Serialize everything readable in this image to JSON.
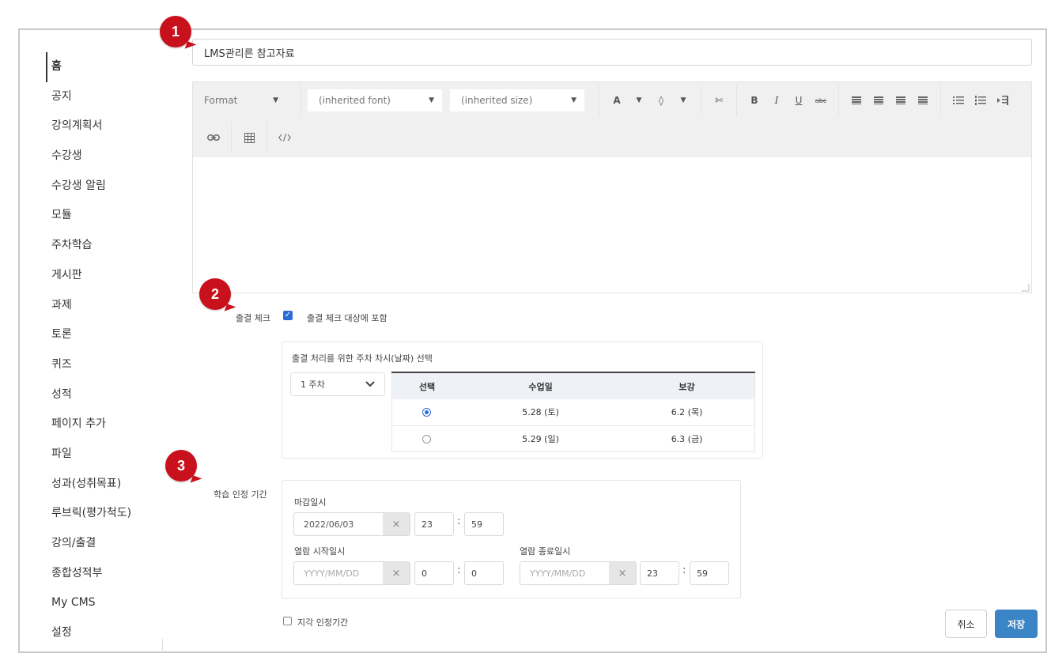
{
  "sidebar": {
    "items": [
      {
        "label": "홈",
        "active": true
      },
      {
        "label": "공지"
      },
      {
        "label": "강의계획서"
      },
      {
        "label": "수강생"
      },
      {
        "label": "수강생 알림"
      },
      {
        "label": "모듈"
      },
      {
        "label": "주차학습"
      },
      {
        "label": "게시판"
      },
      {
        "label": "과제"
      },
      {
        "label": "토론"
      },
      {
        "label": "퀴즈"
      },
      {
        "label": "성적"
      },
      {
        "label": "페이지 추가"
      },
      {
        "label": "파일"
      },
      {
        "label": "성과(성취목표)"
      },
      {
        "label": "루브릭(평가척도)"
      },
      {
        "label": "강의/출결"
      },
      {
        "label": "종합성적부"
      },
      {
        "label": "My CMS"
      },
      {
        "label": "설정"
      }
    ]
  },
  "badges": [
    "1",
    "2",
    "3"
  ],
  "title_input": {
    "value": "LMS관리른 참고자료"
  },
  "toolbar": {
    "format": "Format",
    "font": "(inherited font)",
    "size": "(inherited size)",
    "text_color": "A",
    "bg_color": "◊",
    "clear": "✄",
    "bold": "B",
    "italic": "I",
    "underline": "U",
    "strike": "abc",
    "caret": "▼"
  },
  "attendance": {
    "label": "출결 체크",
    "checkbox_label": "출결 체크 대상에 포함",
    "checked": true,
    "box_title": "출결 처리를 위한 주차 차시(날짜) 선택",
    "week": "1 주차",
    "table": {
      "headers": [
        "선택",
        "수업일",
        "보강"
      ],
      "rows": [
        {
          "selected": true,
          "class_date": "5.28 (토)",
          "makeup": "6.2 (목)"
        },
        {
          "selected": false,
          "class_date": "5.29 (일)",
          "makeup": "6.3 (금)"
        }
      ]
    }
  },
  "learning_period": {
    "label": "학습 인정 기간",
    "deadline_label": "마감일시",
    "deadline_date": "2022/06/03",
    "deadline_hour": "23",
    "deadline_min": "59",
    "view_start_label": "열람 시작일시",
    "view_start_placeholder": "YYYY/MM/DD",
    "view_start_hour": "0",
    "view_start_min": "0",
    "view_end_label": "열람 종료일시",
    "view_end_placeholder": "YYYY/MM/DD",
    "view_end_hour": "23",
    "view_end_min": "59",
    "clear_glyph": "×",
    "colon": ":"
  },
  "late": {
    "label": "지각 인정기간",
    "checked": false
  },
  "buttons": {
    "cancel": "취소",
    "save": "저장"
  },
  "colors": {
    "badge": "#c8111d",
    "save_button": "#3b84c6",
    "checkbox": "#2b6bd6"
  }
}
